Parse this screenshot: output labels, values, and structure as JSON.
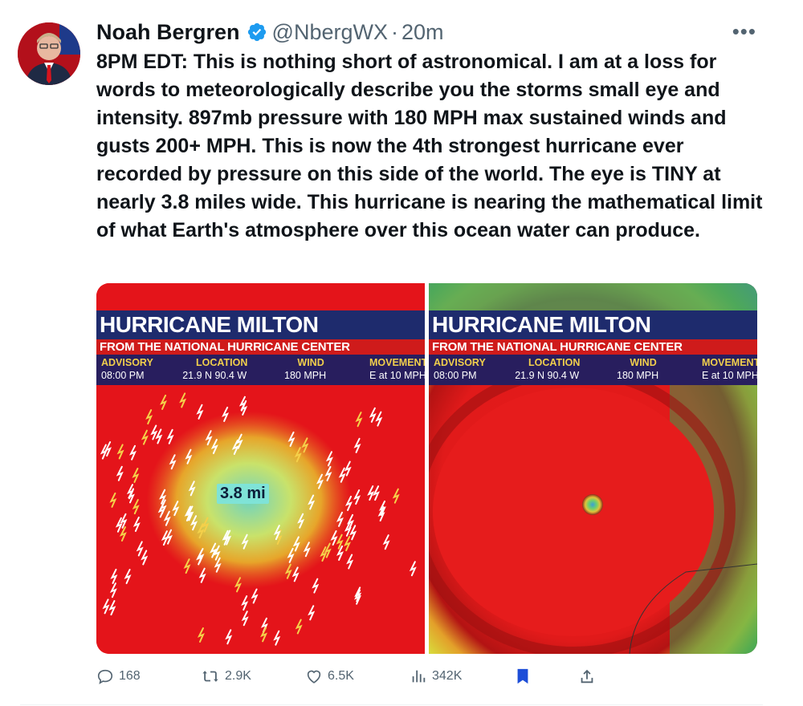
{
  "author": {
    "name": "Noah Bergren",
    "handle": "@NbergWX",
    "separator": "·",
    "time": "20m",
    "verified": true,
    "avatar_icon": "profile-photo"
  },
  "menu_icon": "more-dots-icon",
  "tweet_text": "8PM EDT: This is nothing short of astronomical. I am at a loss for words to meteorologically describe you the storms small eye and intensity. 897mb pressure with 180 MPH max sustained winds and gusts 200+ MPH. This is now the 4th strongest hurricane ever recorded by pressure on this side of the world. The eye is TINY at nearly 3.8 miles wide. This hurricane is nearing the mathematical limit of what Earth's atmosphere over this ocean water can produce.",
  "media": [
    {
      "title": "HURRICANE MILTON",
      "subtitle": "FROM THE NATIONAL HURRICANE CENTER",
      "advisory_label": "ADVISORY",
      "advisory_value": "08:00 PM",
      "location_label": "LOCATION",
      "location_value": "21.9 N 90.4 W",
      "wind_label": "WIND",
      "wind_value": "180 MPH",
      "movement_label": "MOVEMENT",
      "movement_value": "E at 10 MPH",
      "eye_label": "3.8 mi"
    },
    {
      "title": "HURRICANE MILTON",
      "subtitle": "FROM THE NATIONAL HURRICANE CENTER",
      "advisory_label": "ADVISORY",
      "advisory_value": "08:00 PM",
      "location_label": "LOCATION",
      "location_value": "21.9 N 90.4 W",
      "wind_label": "WIND",
      "wind_value": "180 MPH",
      "movement_label": "MOVEMENT",
      "movement_value": "E at 10 MPH"
    }
  ],
  "actions": {
    "replies": "168",
    "reposts": "2.9K",
    "likes": "6.5K",
    "views": "342K"
  },
  "colors": {
    "accent_blue": "#1d9bf0",
    "bookmark_active": "#1d4ed8",
    "muted_text": "#536471",
    "banner_navy": "#1e2b6d",
    "banner_red": "#cf1b1b"
  }
}
